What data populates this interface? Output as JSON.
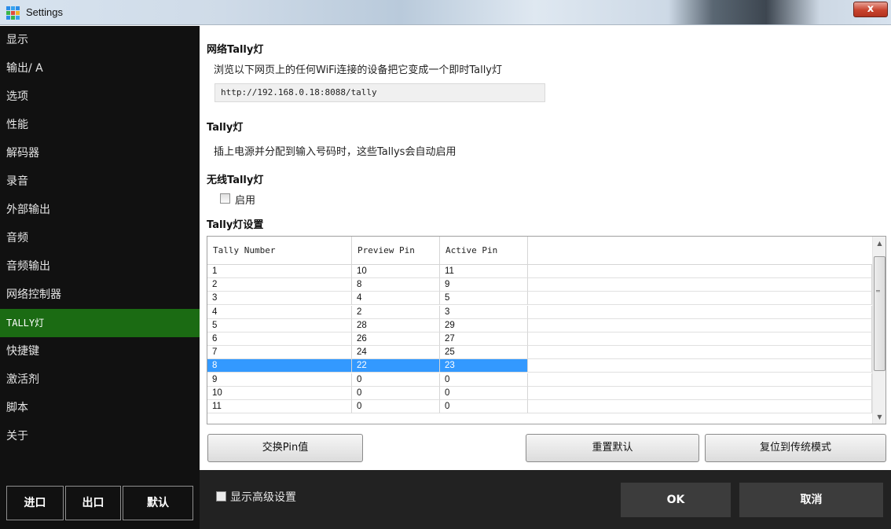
{
  "window": {
    "title": "Settings",
    "close_label": "x",
    "accent_color": "#1b6b13"
  },
  "sidebar": {
    "items": [
      {
        "label": "显示"
      },
      {
        "label": "输出/ A"
      },
      {
        "label": "选项"
      },
      {
        "label": "性能"
      },
      {
        "label": "解码器"
      },
      {
        "label": "录音"
      },
      {
        "label": "外部输出"
      },
      {
        "label": "音频"
      },
      {
        "label": "音频输出"
      },
      {
        "label": "网络控制器"
      },
      {
        "label": "TALLY灯",
        "active": true
      },
      {
        "label": "快捷键"
      },
      {
        "label": "激活剂"
      },
      {
        "label": "脚本"
      },
      {
        "label": "关于"
      }
    ],
    "buttons": {
      "import": "进口",
      "export": "出口",
      "default": "默认"
    }
  },
  "network_tally": {
    "title": "网络Tally灯",
    "description": "浏览以下网页上的任何WiFi连接的设备把它变成一个即时Tally灯",
    "url": "http://192.168.0.18:8088/tally"
  },
  "tally": {
    "title": "Tally灯",
    "description": "插上电源并分配到输入号码时，这些Tallys会自动启用"
  },
  "wireless_tally": {
    "title": "无线Tally灯",
    "enable_label": "启用",
    "enabled": false
  },
  "tally_settings": {
    "title": "Tally灯设置",
    "columns": [
      "Tally Number",
      "Preview Pin",
      "Active Pin"
    ],
    "rows": [
      [
        "1",
        "10",
        "11"
      ],
      [
        "2",
        "8",
        "9"
      ],
      [
        "3",
        "4",
        "5"
      ],
      [
        "4",
        "2",
        "3"
      ],
      [
        "5",
        "28",
        "29"
      ],
      [
        "6",
        "26",
        "27"
      ],
      [
        "7",
        "24",
        "25"
      ],
      [
        "8",
        "22",
        "23"
      ],
      [
        "9",
        "0",
        "0"
      ],
      [
        "10",
        "0",
        "0"
      ],
      [
        "11",
        "0",
        "0"
      ]
    ],
    "selected_row": 8,
    "selection_color": "#3399ff"
  },
  "actions": {
    "swap_pin": "交换Pin值",
    "reset_default": "重置默认",
    "reset_legacy": "复位到传统模式"
  },
  "footer": {
    "show_advanced_label": "显示高级设置",
    "ok": "OK",
    "cancel": "取消"
  }
}
